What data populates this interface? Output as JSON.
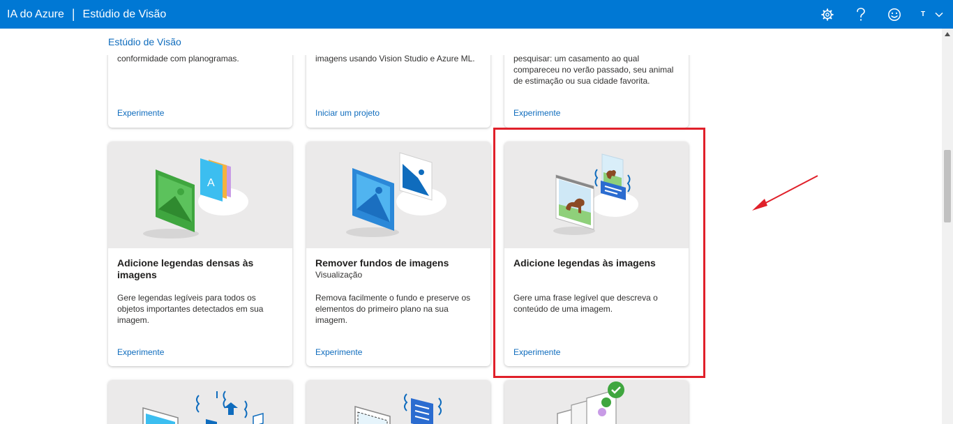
{
  "header": {
    "brand": "IA do Azure",
    "separator": "|",
    "product": "Estúdio de Visão",
    "user_initial": "T"
  },
  "breadcrumb": {
    "label": "Estúdio de Visão"
  },
  "top_cards": [
    {
      "desc": "conformidade com planogramas.",
      "link": "Experimente"
    },
    {
      "desc": "imagens usando Vision Studio e Azure ML.",
      "link": "Iniciar um projeto"
    },
    {
      "desc": "pesquisar: um casamento ao qual compareceu no verão passado, seu animal de estimação ou sua cidade favorita.",
      "link": "Experimente"
    }
  ],
  "middle_cards": [
    {
      "title": "Adicione legendas densas às imagens",
      "subtitle": "",
      "desc": "Gere legendas legíveis para todos os objetos importantes detectados em sua imagem.",
      "link": "Experimente"
    },
    {
      "title": "Remover fundos de imagens",
      "subtitle": "Visualização",
      "desc": "Remova facilmente o fundo e preserve os elementos do primeiro plano na sua imagem.",
      "link": "Experimente"
    },
    {
      "title": "Adicione legendas às imagens",
      "subtitle": "",
      "desc": "Gere uma frase legível que descreva o conteúdo de uma imagem.",
      "link": "Experimente"
    }
  ],
  "colors": {
    "header_bg": "#0078d4",
    "link": "#0f6cbd",
    "annotation": "#e0202a",
    "hero_bg": "#ebeaea"
  },
  "icons": [
    "settings-icon",
    "help-icon",
    "feedback-smiley-icon",
    "chevron-down-icon"
  ]
}
